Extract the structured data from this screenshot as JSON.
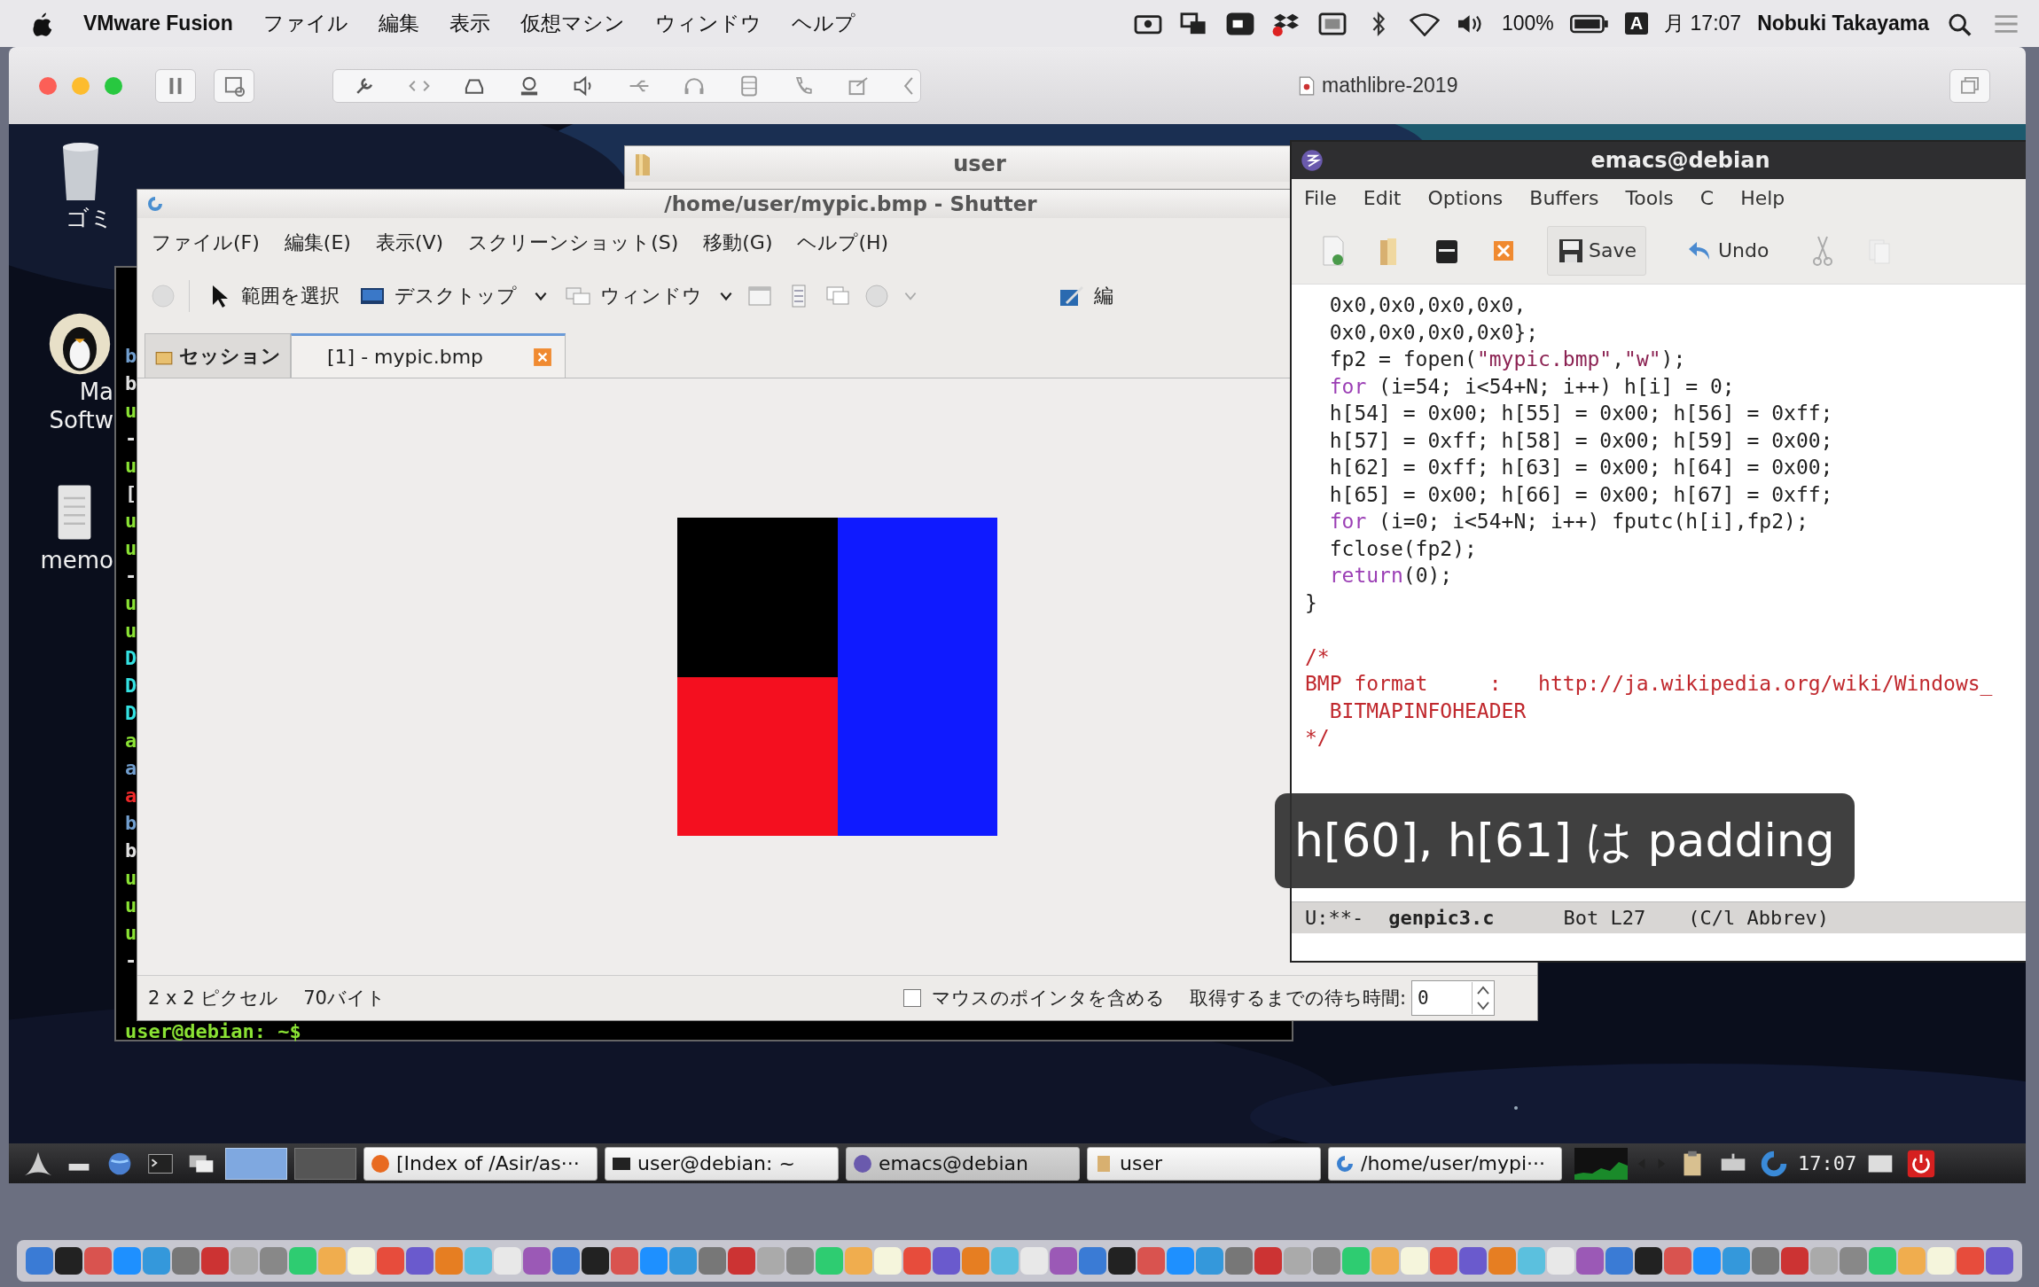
{
  "mac_menubar": {
    "app": "VMware Fusion",
    "menus": [
      "ファイル",
      "編集",
      "表示",
      "仮想マシン",
      "ウィンドウ",
      "ヘルプ"
    ],
    "battery": "100%",
    "input_source": "A",
    "clock": "月 17:07",
    "user": "Nobuki Takayama"
  },
  "vmware": {
    "title": "mathlibre-2019"
  },
  "desktop_icons": [
    {
      "kind": "trash",
      "lines": [
        "ゴミ"
      ]
    },
    {
      "kind": "penguin",
      "lines": [
        "Ma",
        "Softw"
      ]
    },
    {
      "kind": "file",
      "lines": [
        "memo"
      ]
    }
  ],
  "terminal": {
    "lines": [
      {
        "text": "b",
        "color": "#729fcf"
      },
      {
        "text": "b",
        "color": "#e0e0e0"
      },
      {
        "text": "u",
        "color": "#8ae234"
      },
      {
        "text": "-",
        "color": "#e0e0e0"
      },
      {
        "text": "u",
        "color": "#8ae234"
      },
      {
        "text": "[",
        "color": "#e0e0e0"
      },
      {
        "text": "u",
        "color": "#8ae234"
      },
      {
        "text": "u",
        "color": "#8ae234"
      },
      {
        "text": "-",
        "color": "#e0e0e0"
      },
      {
        "text": "u",
        "color": "#8ae234"
      },
      {
        "text": "u",
        "color": "#8ae234"
      },
      {
        "text": "D",
        "color": "#34e2e2"
      },
      {
        "text": "D",
        "color": "#34e2e2"
      },
      {
        "text": "D",
        "color": "#34e2e2"
      },
      {
        "text": "a",
        "color": "#8ae234"
      },
      {
        "text": "a",
        "color": "#729fcf"
      },
      {
        "text": "a",
        "color": "#ef2929"
      },
      {
        "text": "b",
        "color": "#729fcf"
      },
      {
        "text": "b",
        "color": "#e0e0e0"
      },
      {
        "text": "u",
        "color": "#8ae234"
      },
      {
        "text": "u",
        "color": "#8ae234"
      },
      {
        "text": "u",
        "color": "#8ae234"
      },
      {
        "text": "-",
        "color": "#e0e0e0"
      }
    ],
    "prompt": "user@debian: ~$"
  },
  "file_window": {
    "title": "user"
  },
  "shutter": {
    "title": "/home/user/mypic.bmp - Shutter",
    "menus": [
      "ファイル(F)",
      "編集(E)",
      "表示(V)",
      "スクリーンショット(S)",
      "移動(G)",
      "ヘルプ(H)"
    ],
    "toolbar": {
      "select": "範囲を選択",
      "desktop": "デスクトップ",
      "window": "ウィンドウ",
      "edit": "編"
    },
    "tabs": [
      {
        "label": "セッション",
        "selected": false
      },
      {
        "label": "[1] - mypic.bmp",
        "selected": true
      }
    ],
    "pixels": [
      {
        "color": "#000000"
      },
      {
        "color": "#0f1aff"
      },
      {
        "color": "#f40f1f"
      },
      {
        "color": "#0f1aff"
      }
    ],
    "status": {
      "size": "2 x 2 ピクセル",
      "bytes": "70バイト",
      "pointer_label": "マウスのポインタを含める",
      "pointer_checked": false,
      "delay_label": "取得するまでの待ち時間:",
      "delay": "0"
    }
  },
  "emacs": {
    "title": "emacs@debian",
    "menus": [
      "File",
      "Edit",
      "Options",
      "Buffers",
      "Tools",
      "C",
      "Help"
    ],
    "save": "Save",
    "undo": "Undo",
    "code": [
      {
        "kind": "code",
        "segments": [
          {
            "kind": "plain",
            "text": "  0x0,0x0,0x0,0x0,"
          }
        ]
      },
      {
        "kind": "code",
        "segments": [
          {
            "kind": "plain",
            "text": "  0x0,0x0,0x0,0x0};"
          }
        ]
      },
      {
        "kind": "code",
        "segments": [
          {
            "kind": "plain",
            "text": "  fp2 = fopen("
          },
          {
            "kind": "string",
            "text": "\"mypic.bmp\""
          },
          {
            "kind": "plain",
            "text": ","
          },
          {
            "kind": "string",
            "text": "\"w\""
          },
          {
            "kind": "plain",
            "text": ");"
          }
        ]
      },
      {
        "kind": "code",
        "segments": [
          {
            "kind": "keyword",
            "text": "  for"
          },
          {
            "kind": "plain",
            "text": " (i=54; i<54+N; i++) h[i] = 0;"
          }
        ]
      },
      {
        "kind": "code",
        "segments": [
          {
            "kind": "plain",
            "text": "  h[54] = 0x00; h[55] = 0x00; h[56] = 0xff;"
          }
        ]
      },
      {
        "kind": "code",
        "segments": [
          {
            "kind": "plain",
            "text": "  h[57] = 0xff; h[58] = 0x00; h[59] = 0x00;"
          }
        ]
      },
      {
        "kind": "code",
        "segments": [
          {
            "kind": "plain",
            "text": "  h[62] = 0xff; h[63] = 0x00; h[64] = 0x00;"
          }
        ]
      },
      {
        "kind": "code",
        "segments": [
          {
            "kind": "plain",
            "text": "  h[65] = 0x00; h[66] = 0x00; h[67] = 0xff;"
          }
        ]
      },
      {
        "kind": "code",
        "segments": [
          {
            "kind": "keyword",
            "text": "  for"
          },
          {
            "kind": "plain",
            "text": " (i=0; i<54+N; i++) fputc(h[i],fp2);"
          }
        ]
      },
      {
        "kind": "code",
        "segments": [
          {
            "kind": "plain",
            "text": "  fclose(fp2);"
          }
        ]
      },
      {
        "kind": "code",
        "segments": [
          {
            "kind": "keyword",
            "text": "  return"
          },
          {
            "kind": "plain",
            "text": "(0);"
          }
        ]
      },
      {
        "kind": "code",
        "segments": [
          {
            "kind": "plain",
            "text": "}"
          }
        ]
      },
      {
        "kind": "blank"
      },
      {
        "kind": "code",
        "segments": [
          {
            "kind": "comment",
            "text": "/*"
          }
        ]
      },
      {
        "kind": "code",
        "segments": [
          {
            "kind": "comment",
            "text": "BMP format     :   http://ja.wikipedia.org/wiki/Windows_"
          }
        ]
      },
      {
        "kind": "code",
        "segments": [
          {
            "kind": "comment",
            "text": "  BITMAPINFOHEADER"
          }
        ]
      },
      {
        "kind": "code",
        "segments": [
          {
            "kind": "comment",
            "text": "*/"
          }
        ]
      }
    ],
    "modeline": {
      "status": "U:**-",
      "buffer": "genpic3.c",
      "position": "Bot L27",
      "mode": "(C/l Abbrev)"
    }
  },
  "subtitle": "h[60], h[61] は padding",
  "taskbar": {
    "items": [
      {
        "kind": "browser",
        "label": "[Index of /Asir/as···",
        "selected": false
      },
      {
        "kind": "terminal",
        "label": "user@debian: ~",
        "selected": false
      },
      {
        "kind": "emacs",
        "label": "emacs@debian",
        "selected": true
      },
      {
        "kind": "folder",
        "label": "user",
        "selected": false
      },
      {
        "kind": "shutter",
        "label": "/home/user/mypi···",
        "selected": false
      }
    ],
    "clock": "17:07"
  }
}
